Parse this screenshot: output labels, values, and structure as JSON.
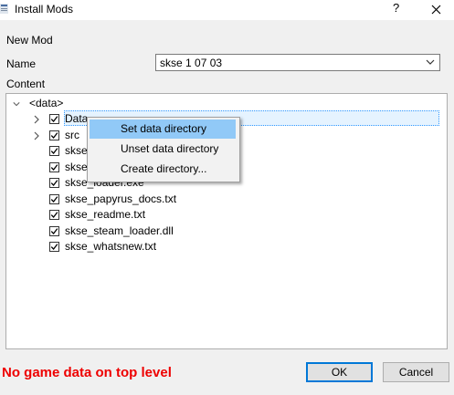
{
  "window": {
    "title": "Install Mods",
    "help": "?",
    "close": "X"
  },
  "form": {
    "group_title": "New Mod",
    "name_label": "Name",
    "name_value": "skse 1 07 03",
    "content_label": "Content"
  },
  "tree": {
    "root": "<data>",
    "items": [
      {
        "label": "Data",
        "checked": true,
        "expandable": true
      },
      {
        "label": "src",
        "checked": true,
        "expandable": true
      },
      {
        "label": "skse_",
        "checked": true,
        "expandable": false
      },
      {
        "label": "skse_",
        "checked": true,
        "expandable": false
      },
      {
        "label": "skse_loader.exe",
        "checked": true,
        "expandable": false
      },
      {
        "label": "skse_papyrus_docs.txt",
        "checked": true,
        "expandable": false
      },
      {
        "label": "skse_readme.txt",
        "checked": true,
        "expandable": false
      },
      {
        "label": "skse_steam_loader.dll",
        "checked": true,
        "expandable": false
      },
      {
        "label": "skse_whatsnew.txt",
        "checked": true,
        "expandable": false
      }
    ]
  },
  "context_menu": {
    "items": [
      "Set data directory",
      "Unset data directory",
      "Create directory..."
    ],
    "highlighted_index": 0
  },
  "status": {
    "warning": "No game data on top level",
    "color": "#ee0000"
  },
  "buttons": {
    "ok": "OK",
    "cancel": "Cancel"
  }
}
